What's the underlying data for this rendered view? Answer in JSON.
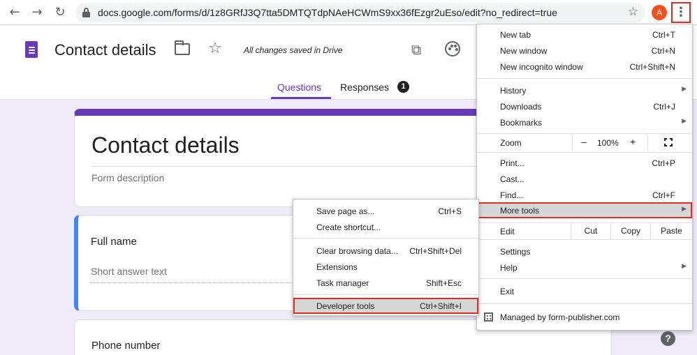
{
  "browser": {
    "url": "docs.google.com/forms/d/1z8GRfJ3Q7tta5DMTQTdpNAeHCWmS9xx36fEzgr2uEso/edit?no_redirect=true",
    "avatar_letter": "A",
    "icons": {
      "back": "arrow-left",
      "forward": "arrow-right",
      "reload": "reload",
      "lock": "lock",
      "bookmark": "star",
      "menu": "three-dot-vertical"
    }
  },
  "forms_header": {
    "title": "Contact details",
    "saved_status": "All changes saved in Drive",
    "tabs": [
      {
        "label": "Questions",
        "active": true
      },
      {
        "label": "Responses",
        "badge": "1"
      }
    ],
    "accent_color": "#673ab7"
  },
  "form": {
    "title": "Contact details",
    "description_placeholder": "Form description",
    "questions": [
      {
        "title": "Full name",
        "answer_placeholder": "Short answer text"
      },
      {
        "title": "Phone number"
      }
    ],
    "help_glyph": "?"
  },
  "main_menu": {
    "items": [
      {
        "label": "New tab",
        "shortcut": "Ctrl+T"
      },
      {
        "label": "New window",
        "shortcut": "Ctrl+N"
      },
      {
        "label": "New incognito window",
        "shortcut": "Ctrl+Shift+N"
      },
      {
        "label": "History",
        "submenu": true
      },
      {
        "label": "Downloads",
        "shortcut": "Ctrl+J"
      },
      {
        "label": "Bookmarks",
        "submenu": true
      },
      {
        "label": "Print...",
        "shortcut": "Ctrl+P"
      },
      {
        "label": "Cast..."
      },
      {
        "label": "Find...",
        "shortcut": "Ctrl+F"
      },
      {
        "label": "More tools",
        "submenu": true,
        "highlighted": true
      },
      {
        "label": "Settings"
      },
      {
        "label": "Help",
        "submenu": true
      },
      {
        "label": "Exit"
      }
    ],
    "zoom": {
      "label": "Zoom",
      "minus": "–",
      "value": "100%",
      "plus": "+"
    },
    "edit": {
      "label": "Edit",
      "cut": "Cut",
      "copy": "Copy",
      "paste": "Paste"
    },
    "managed": "Managed by form-publisher.com",
    "arrow_glyph": "▶"
  },
  "more_tools_menu": {
    "items": [
      {
        "label": "Save page as...",
        "shortcut": "Ctrl+S"
      },
      {
        "label": "Create shortcut..."
      },
      {
        "label": "Clear browsing data...",
        "shortcut": "Ctrl+Shift+Del"
      },
      {
        "label": "Extensions"
      },
      {
        "label": "Task manager",
        "shortcut": "Shift+Esc"
      },
      {
        "label": "Developer tools",
        "shortcut": "Ctrl+Shift+I",
        "highlighted": true
      }
    ]
  },
  "colors": {
    "highlight_border": "#d93025",
    "highlight_fill": "#d6d6d6",
    "forms_purple": "#673ab7",
    "question_accent": "#4285f4",
    "background": "#f0ebf8"
  }
}
